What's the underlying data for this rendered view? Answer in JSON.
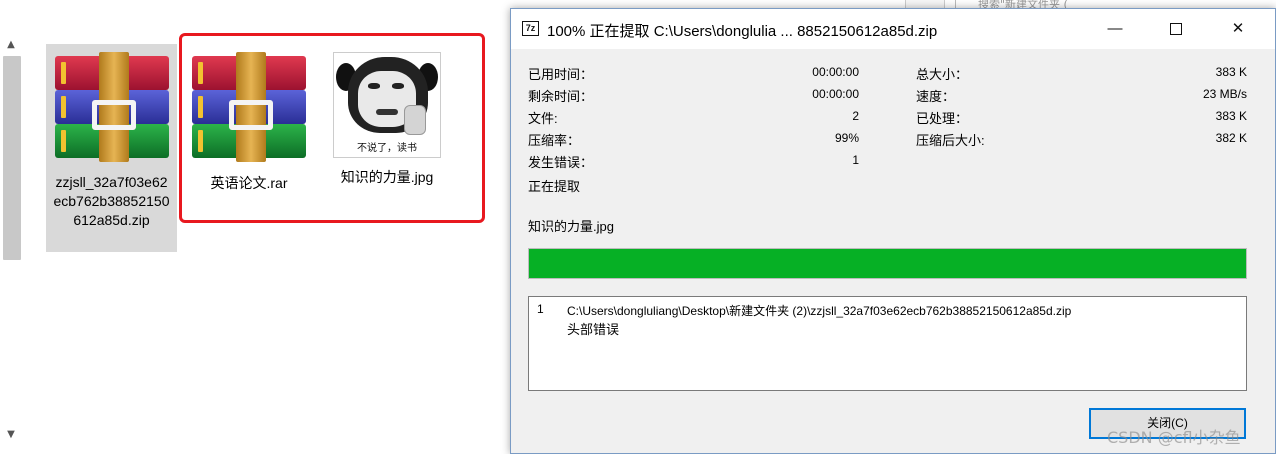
{
  "explorer": {
    "search_placeholder": "搜索\"新建文件夹 (",
    "files": [
      {
        "name": "zzjsll_32a7f03e62ecb762b38852150612a85d.zip",
        "icon": "winrar-archive-icon",
        "selected": true
      },
      {
        "name": "英语论文.rar",
        "icon": "winrar-archive-icon",
        "selected": false
      },
      {
        "name": "知识的力量.jpg",
        "icon": "panda-meme-thumbnail",
        "thumbnail_caption": "不说了，读书",
        "selected": false
      }
    ],
    "highlight_color": "#e8181f"
  },
  "dialog": {
    "app_icon": "7z",
    "title": "100% 正在提取 C:\\Users\\donglulia ... 8852150612a85d.zip",
    "window_buttons": {
      "minimize": "—",
      "close": "✕"
    },
    "stats_left": [
      {
        "label": "已用时间：",
        "value": "00:00:00"
      },
      {
        "label": "剩余时间：",
        "value": "00:00:00"
      },
      {
        "label": "文件:",
        "value": "2"
      },
      {
        "label": "压缩率：",
        "value": "99%"
      },
      {
        "label": "发生错误：",
        "value": "1"
      }
    ],
    "stats_right": [
      {
        "label": "总大小：",
        "value": "383 K"
      },
      {
        "label": "速度：",
        "value": "23 MB/s"
      },
      {
        "label": "已处理：",
        "value": "383 K"
      },
      {
        "label": "压缩后大小:",
        "value": "382 K"
      }
    ],
    "status": "正在提取",
    "current_file": "知识的力量.jpg",
    "progress_percent": 100,
    "progress_color": "#06b025",
    "log": [
      {
        "index": "1",
        "path": "C:\\Users\\dongluliang\\Desktop\\新建文件夹 (2)\\zzjsll_32a7f03e62ecb762b38852150612a85d.zip",
        "message": "头部错误"
      }
    ],
    "close_button": "关闭(C)"
  },
  "watermark": "CSDN @cfl小杂鱼"
}
